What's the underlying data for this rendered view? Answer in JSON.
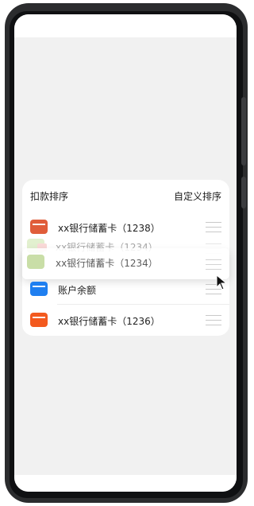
{
  "header": {
    "left": "扣款排序",
    "right": "自定义排序"
  },
  "rows": [
    {
      "label": "xx银行储蓄卡（1238）",
      "icon": "bank-card-icon",
      "color": "#e05d3a"
    },
    {
      "label": "账户余额",
      "icon": "wallet-icon",
      "color": "#1f7ff0"
    },
    {
      "label": "xx银行储蓄卡（1236）",
      "icon": "bank-card-icon",
      "color": "#f35a1f"
    }
  ],
  "dragging": {
    "back": {
      "label": "xx银行储蓄卡（1234）",
      "icon_color": "#b9db8a",
      "accent": "#f0a6a0"
    },
    "front": {
      "label": "xx银行储蓄卡（1234）",
      "icon_color": "#b7d38a"
    }
  },
  "icons": {
    "drag": "drag-handle-icon",
    "cursor": "mouse-pointer-icon"
  }
}
